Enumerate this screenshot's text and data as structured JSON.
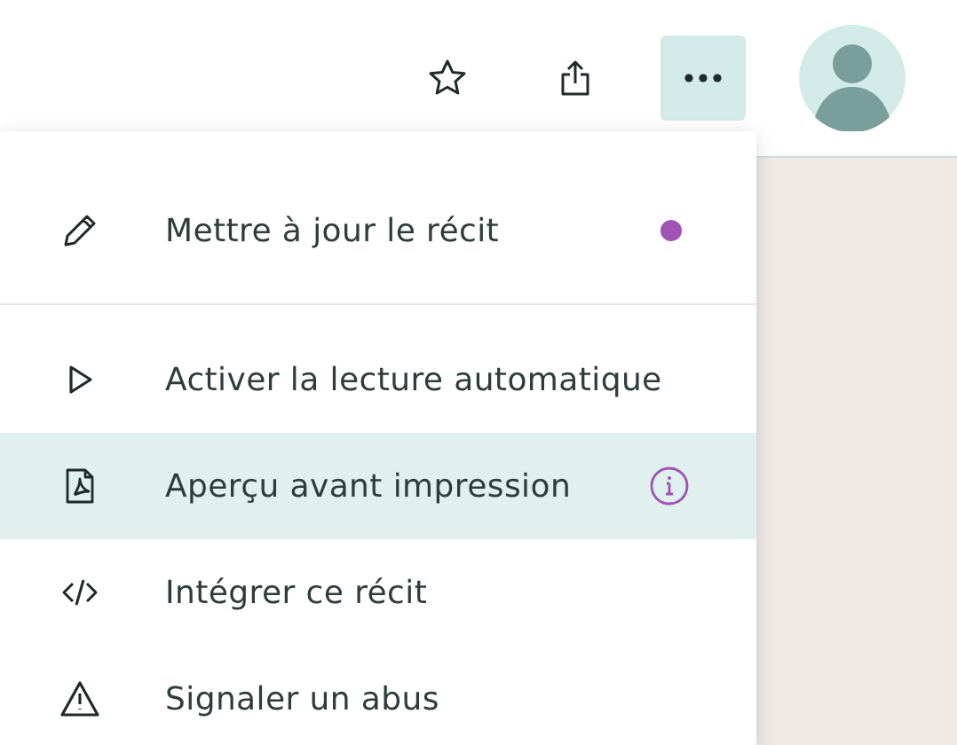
{
  "toolbar": {
    "more_button": {
      "expanded": true
    }
  },
  "menu": {
    "sections": [
      [
        {
          "label": "Mettre à jour le récit",
          "selected": false,
          "indicator": {
            "kind": "dot"
          }
        }
      ],
      [
        {
          "label": "Activer la lecture automatique",
          "selected": false
        },
        {
          "label": "Aperçu avant impression",
          "selected": true,
          "indicator": {
            "kind": "info"
          }
        },
        {
          "label": "Intégrer ce récit",
          "selected": false
        },
        {
          "label": "Signaler un abus",
          "selected": false
        }
      ]
    ]
  }
}
